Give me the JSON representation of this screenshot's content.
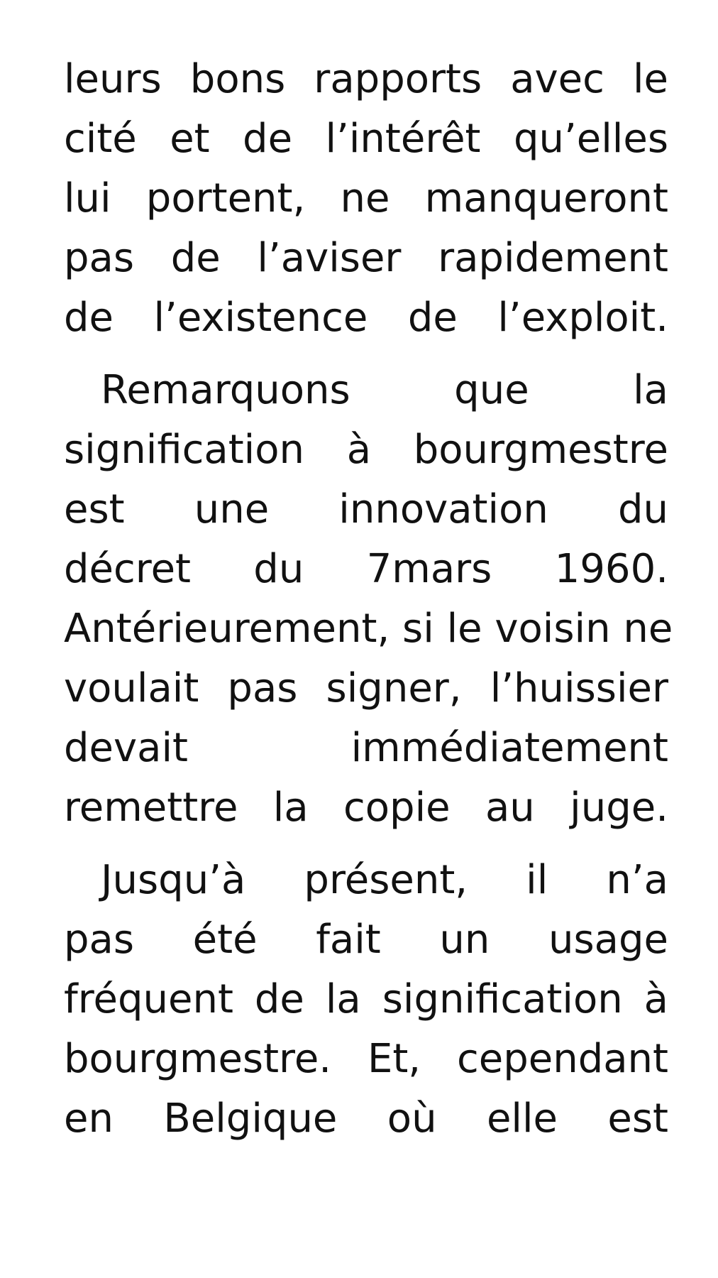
{
  "document": {
    "paragraphs": [
      {
        "lines": [
          "leurs bons rapports avec le",
          "cité et de l’intérêt qu’elles",
          "lui portent, ne manqueront",
          "pas de l’aviser rapidement",
          "de l’existence de l’exploit."
        ]
      },
      {
        "lines": [
          "Remarquons que la",
          "signification à bourgmestre",
          "est une innovation du",
          "décret du 7mars 1960.",
          "Antérieurement, si le voisin ne",
          "voulait pas signer, l’huissier",
          "devait immédiatement",
          "remettre la copie au juge."
        ]
      },
      {
        "lines": [
          "Jusqu’à présent, il n’a",
          "pas été fait un usage",
          "fréquent de la signification à",
          "bourgmestre. Et, cependant",
          "en Belgique où elle est"
        ]
      }
    ]
  }
}
